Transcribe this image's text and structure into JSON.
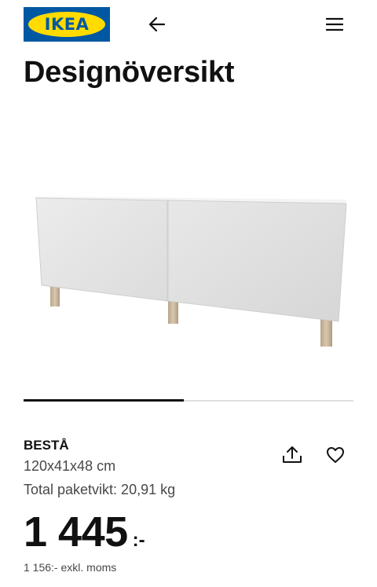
{
  "header": {
    "logo_text": "IKEA",
    "back_icon": "arrow-left-icon",
    "menu_icon": "hamburger-menu-icon"
  },
  "page": {
    "title": "Designöversikt"
  },
  "gallery": {
    "image_alt": "BESTÅ",
    "progress_fraction": 0.5
  },
  "product": {
    "name": "BESTÅ",
    "dimensions": "120x41x48 cm",
    "package_weight": "Total paketvikt: 20,91 kg",
    "price_integer": "1 445",
    "price_suffix": ":-",
    "price_ex_vat": "1 156:- exkl. moms",
    "share_icon": "share-icon",
    "favourite_icon": "heart-icon"
  },
  "colors": {
    "ikea_blue": "#0058a3",
    "ikea_yellow": "#ffdb00",
    "text": "#111111",
    "secondary_text": "#484848"
  }
}
